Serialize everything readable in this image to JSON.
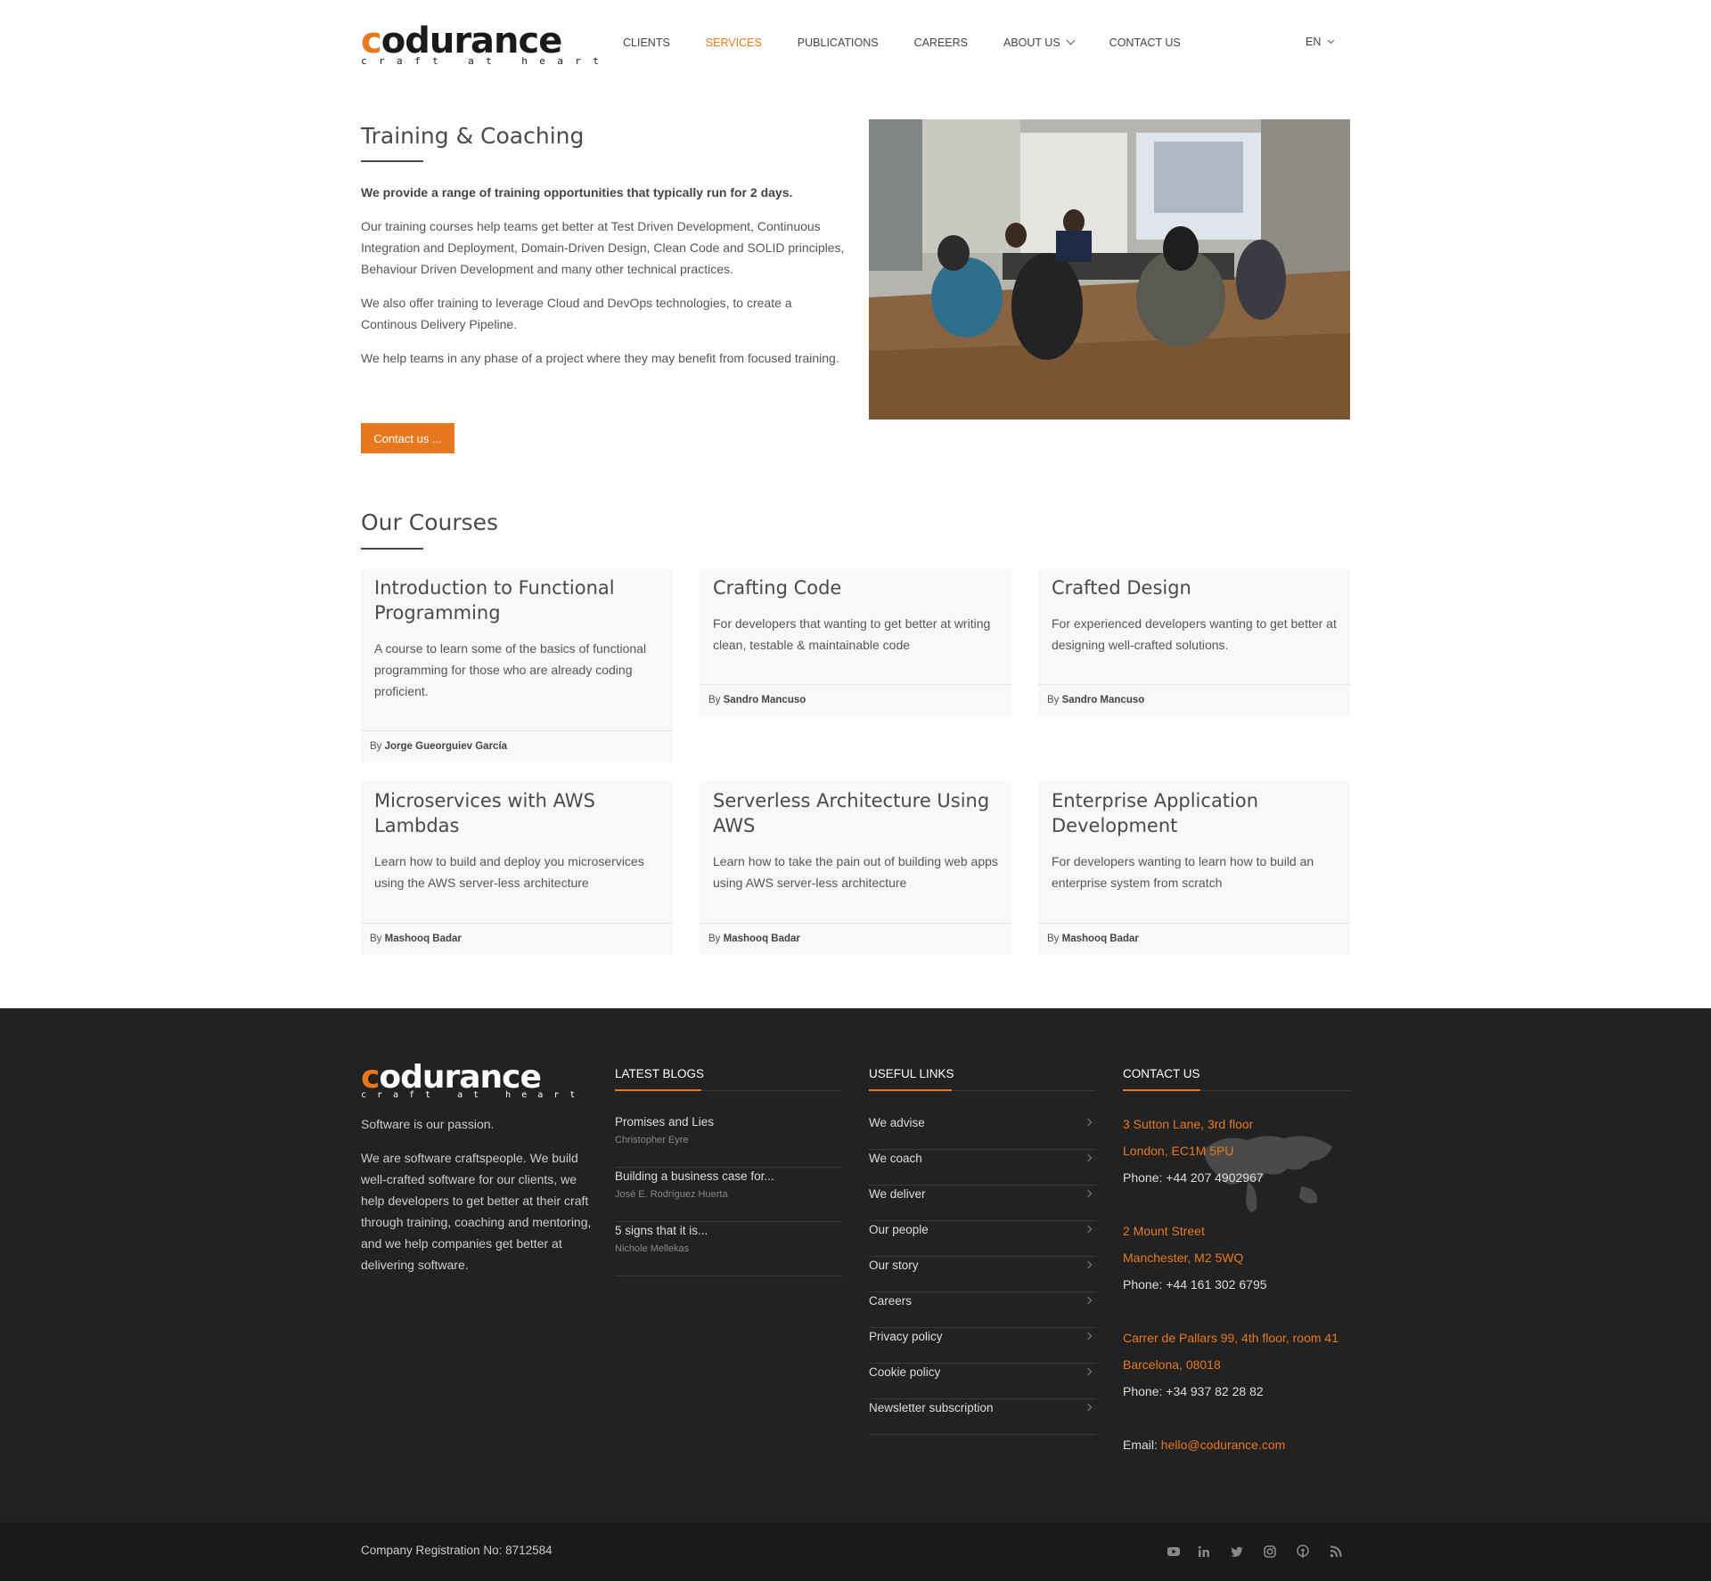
{
  "header": {
    "logo": {
      "word": "codurance",
      "tagline": "craft at heart"
    },
    "nav": [
      {
        "label": "CLIENTS",
        "active": false
      },
      {
        "label": "SERVICES",
        "active": true
      },
      {
        "label": "PUBLICATIONS",
        "active": false
      },
      {
        "label": "CAREERS",
        "active": false
      },
      {
        "label": "ABOUT US",
        "active": false,
        "dropdown": true
      },
      {
        "label": "CONTACT US",
        "active": false
      }
    ],
    "language": "EN"
  },
  "intro": {
    "title": "Training & Coaching",
    "lead": "We provide a range of training opportunities that typically run for 2 days.",
    "paragraphs": [
      "Our training courses help teams get better at Test Driven Development, Continuous Integration and Deployment, Domain-Driven Design, Clean Code and SOLID principles, Behaviour Driven Development and many other technical practices.",
      "We also offer training to leverage Cloud and DevOps technologies, to create a Continous Delivery Pipeline.",
      "We help teams in any phase of a project where they may benefit from focused training."
    ],
    "button": "Contact us ..."
  },
  "courses": {
    "title": "Our Courses",
    "by_prefix": "By",
    "items": [
      {
        "title": "Introduction to Functional Programming",
        "description": "A course to learn some of the basics of functional programming for those who are already coding proficient.",
        "author": "Jorge Gueorguiev García"
      },
      {
        "title": "Crafting Code",
        "description": "For developers that wanting to get better at writing clean, testable & maintainable code",
        "author": "Sandro Mancuso"
      },
      {
        "title": "Crafted Design",
        "description": "For experienced developers wanting to get better at designing well-crafted solutions.",
        "author": "Sandro Mancuso"
      },
      {
        "title": "Microservices with AWS Lambdas",
        "description": "Learn how to build and deploy you microservices using the AWS server-less architecture",
        "author": "Mashooq Badar"
      },
      {
        "title": "Serverless Architecture Using AWS",
        "description": "Learn how to take the pain out of building web apps using AWS server-less architecture",
        "author": "Mashooq Badar"
      },
      {
        "title": "Enterprise Application Development",
        "description": "For developers wanting to learn how to build an enterprise system from scratch",
        "author": "Mashooq Badar"
      }
    ]
  },
  "footer": {
    "about": {
      "tagline": "Software is our passion.",
      "text": "We are software craftspeople. We build well-crafted software for our clients, we help developers to get better at their craft through training, coaching and mentoring, and we help companies get better at delivering software."
    },
    "blogs": {
      "title": "LATEST BLOGS",
      "items": [
        {
          "title": "Promises and Lies",
          "author": "Christopher Eyre"
        },
        {
          "title": "Building a business case for...",
          "author": "José E. Rodríguez Huerta"
        },
        {
          "title": "5 signs that it is...",
          "author": "Nichole Mellekas"
        }
      ]
    },
    "links": {
      "title": "USEFUL LINKS",
      "items": [
        "We advise",
        "We coach",
        "We deliver",
        "Our people",
        "Our story",
        "Careers",
        "Privacy policy",
        "Cookie policy",
        "Newsletter subscription"
      ]
    },
    "contact": {
      "title": "CONTACT US",
      "offices": [
        {
          "line1": "3 Sutton Lane, 3rd floor",
          "line2": "London, EC1M 5PU",
          "phone": "Phone: +44 207 4902967"
        },
        {
          "line1": "2 Mount Street",
          "line2": "Manchester, M2 5WQ",
          "phone": "Phone: +44 161 302 6795"
        },
        {
          "line1": "Carrer de Pallars 99, 4th floor, room 41",
          "line2": "Barcelona, 08018",
          "phone": "Phone: +34 937 82 28 82"
        }
      ],
      "email_label": "Email:",
      "email": "hello@codurance.com"
    },
    "registration": "Company Registration No: 8712584",
    "social": [
      "youtube-icon",
      "linkedin-icon",
      "twitter-icon",
      "instagram-icon",
      "podcast-icon",
      "rss-icon"
    ]
  },
  "colors": {
    "accent": "#e8781e",
    "footer_bg": "#222222",
    "bottom_bar_bg": "#1a1a1a",
    "text": "#555555"
  }
}
